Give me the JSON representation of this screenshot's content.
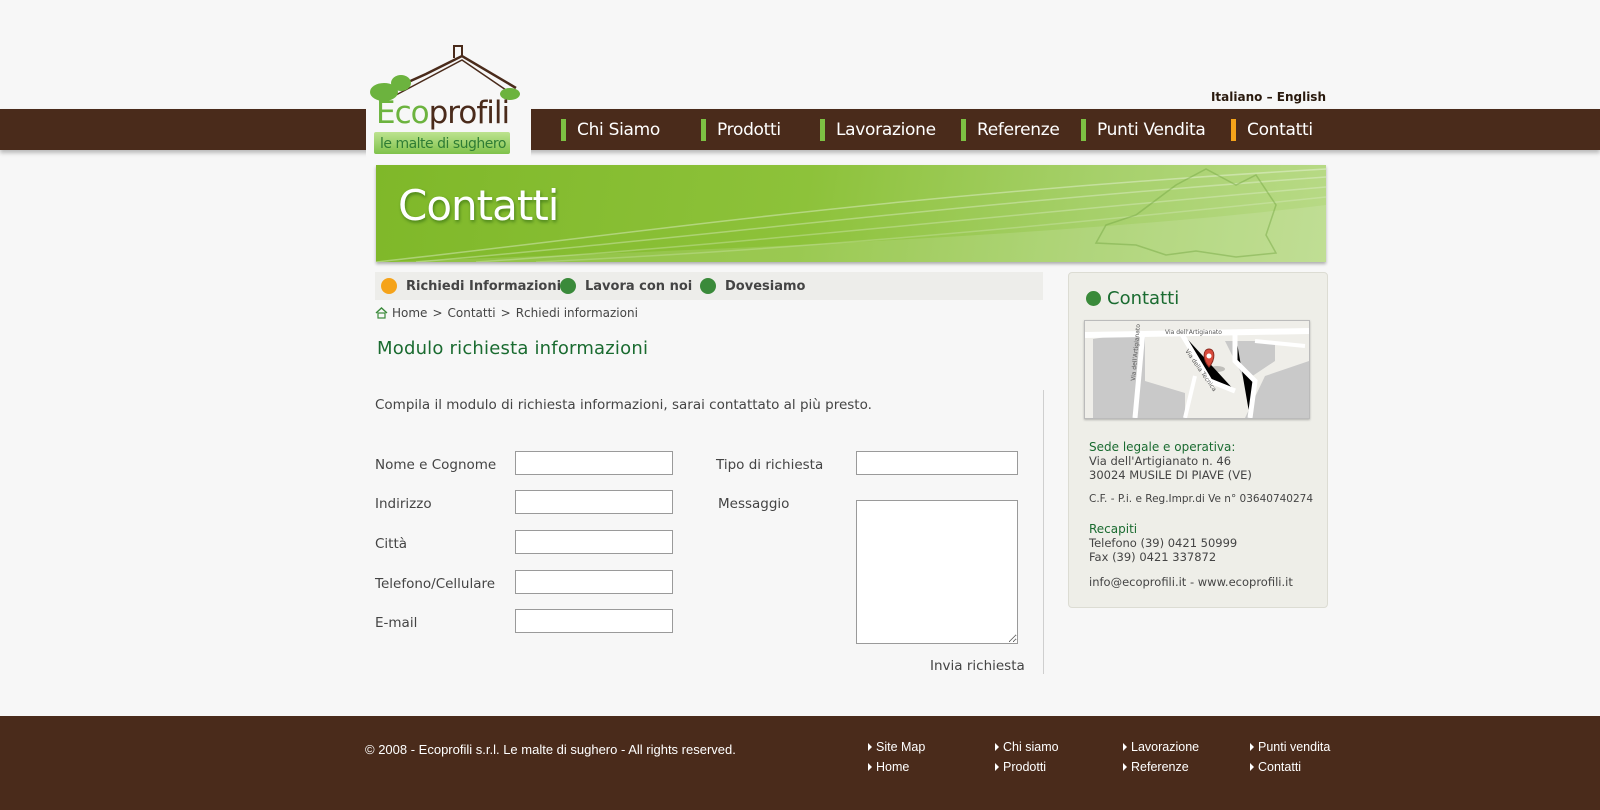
{
  "language": {
    "italian": "Italiano",
    "sep": "–",
    "english": "English"
  },
  "logo": {
    "eco": "Eco",
    "profili": "profili",
    "tagline": "le malte di sughero"
  },
  "nav": [
    {
      "label": "Chi Siamo"
    },
    {
      "label": "Prodotti"
    },
    {
      "label": "Lavorazione"
    },
    {
      "label": "Referenze"
    },
    {
      "label": "Punti Vendita"
    },
    {
      "label": "Contatti",
      "active": true
    }
  ],
  "banner": {
    "title": "Contatti"
  },
  "subnav": [
    {
      "label": "Richiedi Informazioni",
      "active": true
    },
    {
      "label": "Lavora con noi"
    },
    {
      "label": "Dovesiamo"
    }
  ],
  "breadcrumb": [
    "Home",
    "Contatti",
    "Rchiedi informazioni"
  ],
  "breadcrumb_sep": ">",
  "page_title": "Modulo richiesta informazioni",
  "intro": "Compila il modulo di richiesta informazioni, sarai contattato al più presto.",
  "form": {
    "name_label": "Nome e Cognome",
    "address_label": "Indirizzo",
    "city_label": "Città",
    "phone_label": "Telefono/Cellulare",
    "email_label": "E-mail",
    "request_type_label": "Tipo di richiesta",
    "message_label": "Messaggio",
    "submit_label": "Invia richiesta"
  },
  "sidebar": {
    "title": "Contatti",
    "map_labels": [
      "Via dell'Artigianato",
      "Via dell'Artigianato",
      "Via della Tecnica"
    ],
    "sede_head": "Sede legale e operativa:",
    "address1": "Via dell'Artigianato n. 46",
    "address2": "30024 MUSILE DI PIAVE (VE)",
    "cf": "C.F. - P.i. e Reg.Impr.di Ve n° 03640740274",
    "recapiti_head": "Recapiti",
    "telefono": "Telefono (39) 0421 50999",
    "fax": "Fax (39) 0421 337872",
    "contacts": "info@ecoprofili.it - www.ecoprofili.it"
  },
  "footer": {
    "copyright": "© 2008 - Ecoprofili s.r.l. Le malte di sughero - All rights reserved.",
    "links": [
      "Site Map",
      "Home",
      "Chi siamo",
      "Prodotti",
      "Lavorazione",
      "Referenze",
      "Punti vendita",
      "Contatti"
    ]
  },
  "colors": {
    "brown": "#4a2b1b",
    "green": "#7dc143",
    "dark_green": "#1a6b30",
    "orange": "#f5a31a"
  }
}
